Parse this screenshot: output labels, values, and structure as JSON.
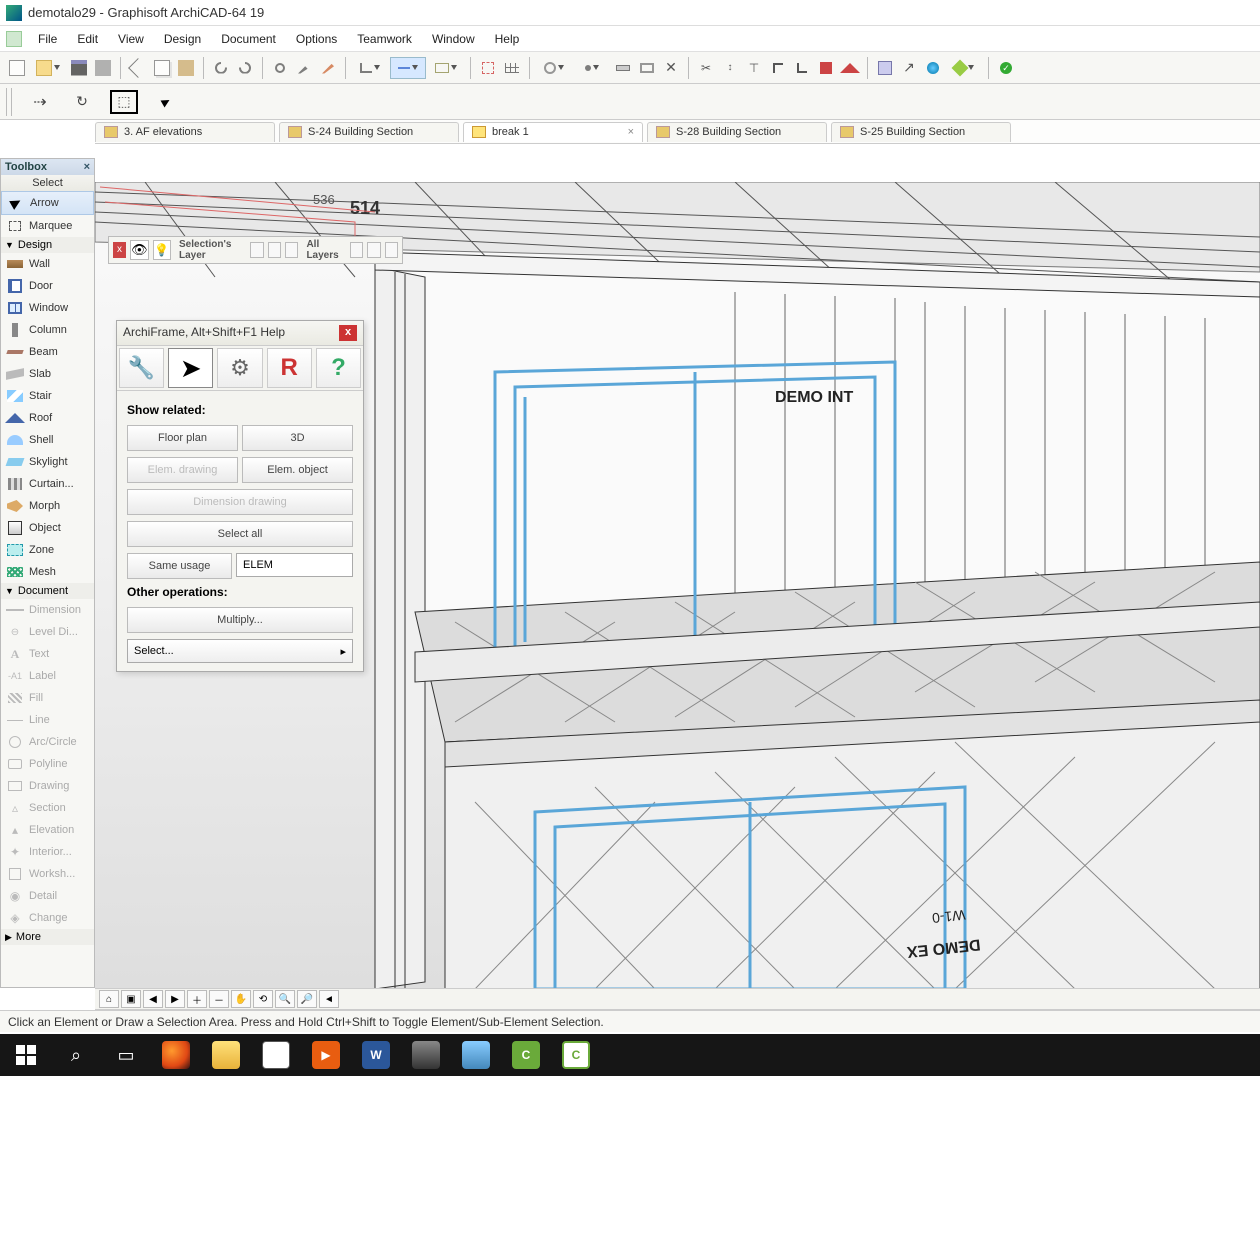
{
  "app": {
    "title": "demotalo29 - Graphisoft ArchiCAD-64 19"
  },
  "menu": {
    "items": [
      "File",
      "Edit",
      "View",
      "Design",
      "Document",
      "Options",
      "Teamwork",
      "Window",
      "Help"
    ]
  },
  "tabs": [
    {
      "label": "3. AF elevations"
    },
    {
      "label": "S-24 Building Section"
    },
    {
      "label": "break 1",
      "active": true
    },
    {
      "label": "S-28 Building Section"
    },
    {
      "label": "S-25 Building Section"
    }
  ],
  "toolbox": {
    "title": "Toolbox",
    "sections": {
      "select_header": "Select",
      "select": [
        {
          "label": "Arrow",
          "selected": true
        },
        {
          "label": "Marquee"
        }
      ],
      "design_header": "Design",
      "design": [
        "Wall",
        "Door",
        "Window",
        "Column",
        "Beam",
        "Slab",
        "Stair",
        "Roof",
        "Shell",
        "Skylight",
        "Curtain...",
        "Morph",
        "Object",
        "Zone",
        "Mesh"
      ],
      "document_header": "Document",
      "document": [
        "Dimension",
        "Level Di...",
        "Text",
        "Label",
        "Fill",
        "Line",
        "Arc/Circle",
        "Polyline",
        "Drawing",
        "Section",
        "Elevation",
        "Interior...",
        "Worksh...",
        "Detail",
        "Change"
      ],
      "more": "More"
    }
  },
  "layerpalette": {
    "sel_label": "Selection's Layer",
    "all_label": "All Layers"
  },
  "archipop": {
    "title": "ArchiFrame, Alt+Shift+F1 Help",
    "show_related": "Show related:",
    "btn_floorplan": "Floor plan",
    "btn_3d": "3D",
    "btn_elemdraw": "Elem. drawing",
    "btn_elemobj": "Elem. object",
    "btn_dimdraw": "Dimension drawing",
    "btn_selectall": "Select all",
    "btn_sameusage": "Same usage",
    "input_elem": "ELEM",
    "other_ops": "Other operations:",
    "btn_multiply": "Multiply...",
    "select_label": "Select..."
  },
  "viewport_labels": {
    "l1": "DEMO INT",
    "l2": "DEMO EX",
    "l3": "514",
    "l4": "536",
    "l5": "W1-0"
  },
  "status": {
    "text": "Click an Element or Draw a Selection Area. Press and Hold Ctrl+Shift to Toggle Element/Sub-Element Selection."
  }
}
